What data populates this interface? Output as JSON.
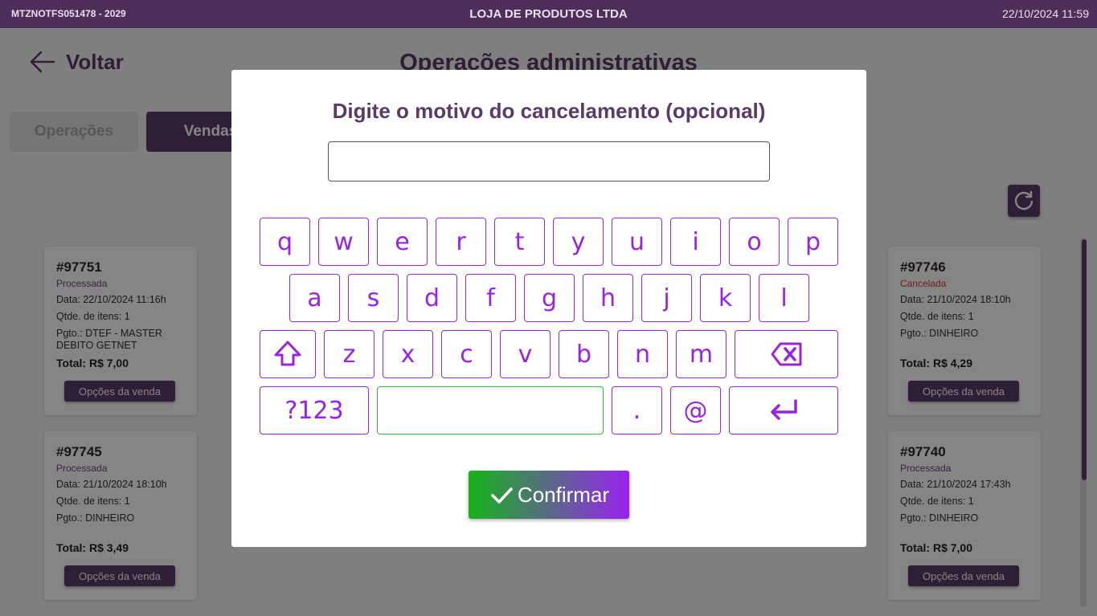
{
  "topbar": {
    "terminal": "MTZNOTFS051478 - 2029",
    "store": "LOJA DE PRODUTOS LTDA",
    "datetime": "22/10/2024 11:59"
  },
  "page": {
    "back_label": "Voltar",
    "title": "Operações administrativas",
    "tabs": [
      "Operações",
      "Vendas"
    ]
  },
  "cards": [
    {
      "num": "#97751",
      "status": "Processada",
      "date": "Data: 22/10/2024 11:16h",
      "qty": "Qtde. de itens: 1",
      "pay": "Pgto.: DTEF - MASTER DEBITO GETNET",
      "total": "Total: R$ 7,00",
      "button": "Opções da venda"
    },
    {
      "num": "#97746",
      "status": "Cancelada",
      "date": "Data: 21/10/2024 18:10h",
      "qty": "Qtde. de itens: 1",
      "pay": "Pgto.: DINHEIRO",
      "total": "Total: R$ 4,29",
      "button": "Opções da venda"
    },
    {
      "num": "#97745",
      "status": "Processada",
      "date": "Data: 21/10/2024 18:10h",
      "qty": "Qtde. de itens: 1",
      "pay": "Pgto.: DINHEIRO",
      "total": "Total: R$ 3,49",
      "button": "Opções da venda"
    },
    {
      "num": "#97740",
      "status": "Processada",
      "date": "Data: 21/10/2024 17:43h",
      "qty": "Qtde. de itens: 1",
      "pay": "Pgto.: DINHEIRO",
      "total": "Total: R$ 7,00",
      "button": "Opções da venda"
    }
  ],
  "modal": {
    "title": "Digite o motivo do cancelamento (opcional)",
    "input_value": "",
    "confirm_label": "Confirmar"
  },
  "keyboard": {
    "row1": [
      "q",
      "w",
      "e",
      "r",
      "t",
      "y",
      "u",
      "i",
      "o",
      "p"
    ],
    "row2": [
      "a",
      "s",
      "d",
      "f",
      "g",
      "h",
      "j",
      "k",
      "l"
    ],
    "row3": [
      "z",
      "x",
      "c",
      "v",
      "b",
      "n",
      "m"
    ],
    "symbols_label": "?123",
    "dot": ".",
    "at": "@"
  },
  "colors": {
    "brand": "#5a3a66",
    "key_accent": "#9a22e0",
    "confirm_start": "#17b31b",
    "confirm_end": "#9a22f0"
  }
}
